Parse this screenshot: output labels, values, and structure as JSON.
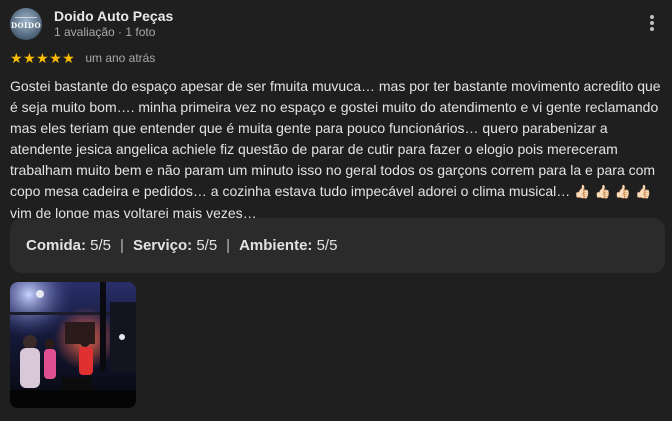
{
  "review": {
    "author_name": "Doido Auto Peças",
    "author_meta": "1 avaliação · 1 foto",
    "avatar_text": "DOIDO",
    "stars": 5,
    "star_glyph": "★",
    "date": "um ano atrás",
    "text": "Gostei bastante do espaço apesar de ser fmuita muvuca… mas por ter bastante movimento acredito que é seja muito bom…. minha primeira vez no espaço e gostei muito do atendimento e vi gente reclamando mas eles teriam que entender que é muita gente para pouco funcionários… quero parabenizar a atendente jesica angelica achiele fiz questão de parar de cutir para fazer o elogio pois mereceram trabalham muito bem e não param um minuto isso no geral todos os garçons correm para la e para com copo mesa cadeira e pedidos… a cozinha estava tudo impecável adorei o clima musical… ",
    "emojis": "👍🏻 👍🏻 👍🏻 👍🏻",
    "text_end": "vim de longe mas voltarei mais vezes…",
    "attributes": [
      {
        "label": "Comida:",
        "value": "5/5"
      },
      {
        "label": "Serviço:",
        "value": "5/5"
      },
      {
        "label": "Ambiente:",
        "value": "5/5"
      }
    ],
    "separator": "|",
    "icons": {
      "more": "more-vert-icon",
      "star": "star-icon",
      "photo": "review-photo"
    },
    "colors": {
      "star": "#fbbc04",
      "background": "#1f1f1f",
      "attr_box": "#2b2b2b"
    }
  }
}
